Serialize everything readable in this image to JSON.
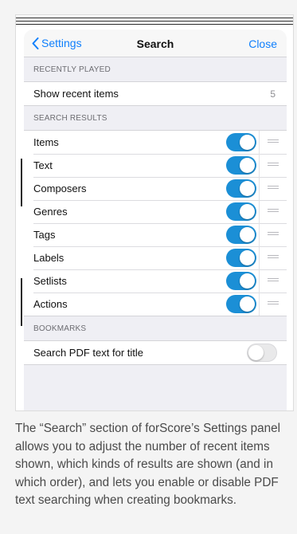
{
  "navbar": {
    "back_label": "Settings",
    "title": "Search",
    "close_label": "Close"
  },
  "recently_played": {
    "header": "RECENTLY PLAYED",
    "row_label": "Show recent items",
    "row_value": "5"
  },
  "search_results": {
    "header": "SEARCH RESULTS",
    "items": [
      {
        "label": "Items",
        "enabled": true
      },
      {
        "label": "Text",
        "enabled": true
      },
      {
        "label": "Composers",
        "enabled": true
      },
      {
        "label": "Genres",
        "enabled": true
      },
      {
        "label": "Tags",
        "enabled": true
      },
      {
        "label": "Labels",
        "enabled": true
      },
      {
        "label": "Setlists",
        "enabled": true
      },
      {
        "label": "Actions",
        "enabled": true
      }
    ]
  },
  "bookmarks": {
    "header": "BOOKMARKS",
    "row_label": "Search PDF text for title",
    "enabled": false
  },
  "caption": "The “Search” section of forScore’s Settings panel allows you to adjust the number of recent items shown, which kinds of results are shown (and in which order), and lets you enable or disable PDF text searching when creating bookmarks.",
  "colors": {
    "accent": "#0f7ffc",
    "toggle_on": "#1b8fd6",
    "panel_bg": "#efeff4"
  }
}
